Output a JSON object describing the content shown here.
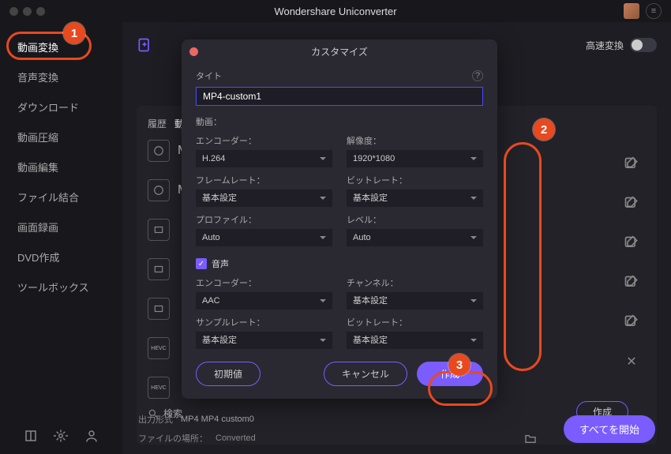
{
  "app": {
    "title": "Wondershare Uniconverter"
  },
  "sidebar": {
    "items": [
      {
        "label": "動画変換",
        "active": true
      },
      {
        "label": "音声変換"
      },
      {
        "label": "ダウンロード"
      },
      {
        "label": "動画圧縮"
      },
      {
        "label": "動画編集"
      },
      {
        "label": "ファイル結合"
      },
      {
        "label": "画面録画"
      },
      {
        "label": "DVD作成"
      },
      {
        "label": "ツールボックス"
      }
    ]
  },
  "topbar": {
    "speed_label": "高速変換"
  },
  "panel": {
    "history_label": "履歴",
    "formats_label_short": "M",
    "search_label": "検索",
    "formats": [
      "M",
      "M",
      "",
      "",
      "",
      "HEVC",
      "HEVC"
    ],
    "create_small": "作成"
  },
  "bottom": {
    "output_fmt_label": "出力形式",
    "output_fmt_value": "MP4 MP4 custom0",
    "location_label": "ファイルの場所：",
    "location_value": "Converted",
    "start_all": "すべてを開始"
  },
  "modal": {
    "title": "カスタマイズ",
    "title_label": "タイト",
    "title_value": "MP4-custom1",
    "video_label": "動画：",
    "encoder_label": "エンコーダー：",
    "encoder_value": "H.264",
    "resolution_label": "解像度：",
    "resolution_value": "1920*1080",
    "framerate_label": "フレームレート：",
    "framerate_value": "基本設定",
    "vbitrate_label": "ビットレート：",
    "vbitrate_value": "基本設定",
    "profile_label": "プロファイル：",
    "profile_value": "Auto",
    "level_label": "レベル：",
    "level_value": "Auto",
    "audio_label": "音声",
    "audio_encoder_label": "エンコーダー：",
    "audio_encoder_value": "AAC",
    "channel_label": "チャンネル：",
    "channel_value": "基本設定",
    "samplerate_label": "サンプルレート：",
    "samplerate_value": "基本設定",
    "abitrate_label": "ビットレート：",
    "abitrate_value": "基本設定",
    "reset": "初期値",
    "cancel": "キャンセル",
    "create": "作成"
  },
  "callouts": {
    "1": "1",
    "2": "2",
    "3": "3"
  }
}
